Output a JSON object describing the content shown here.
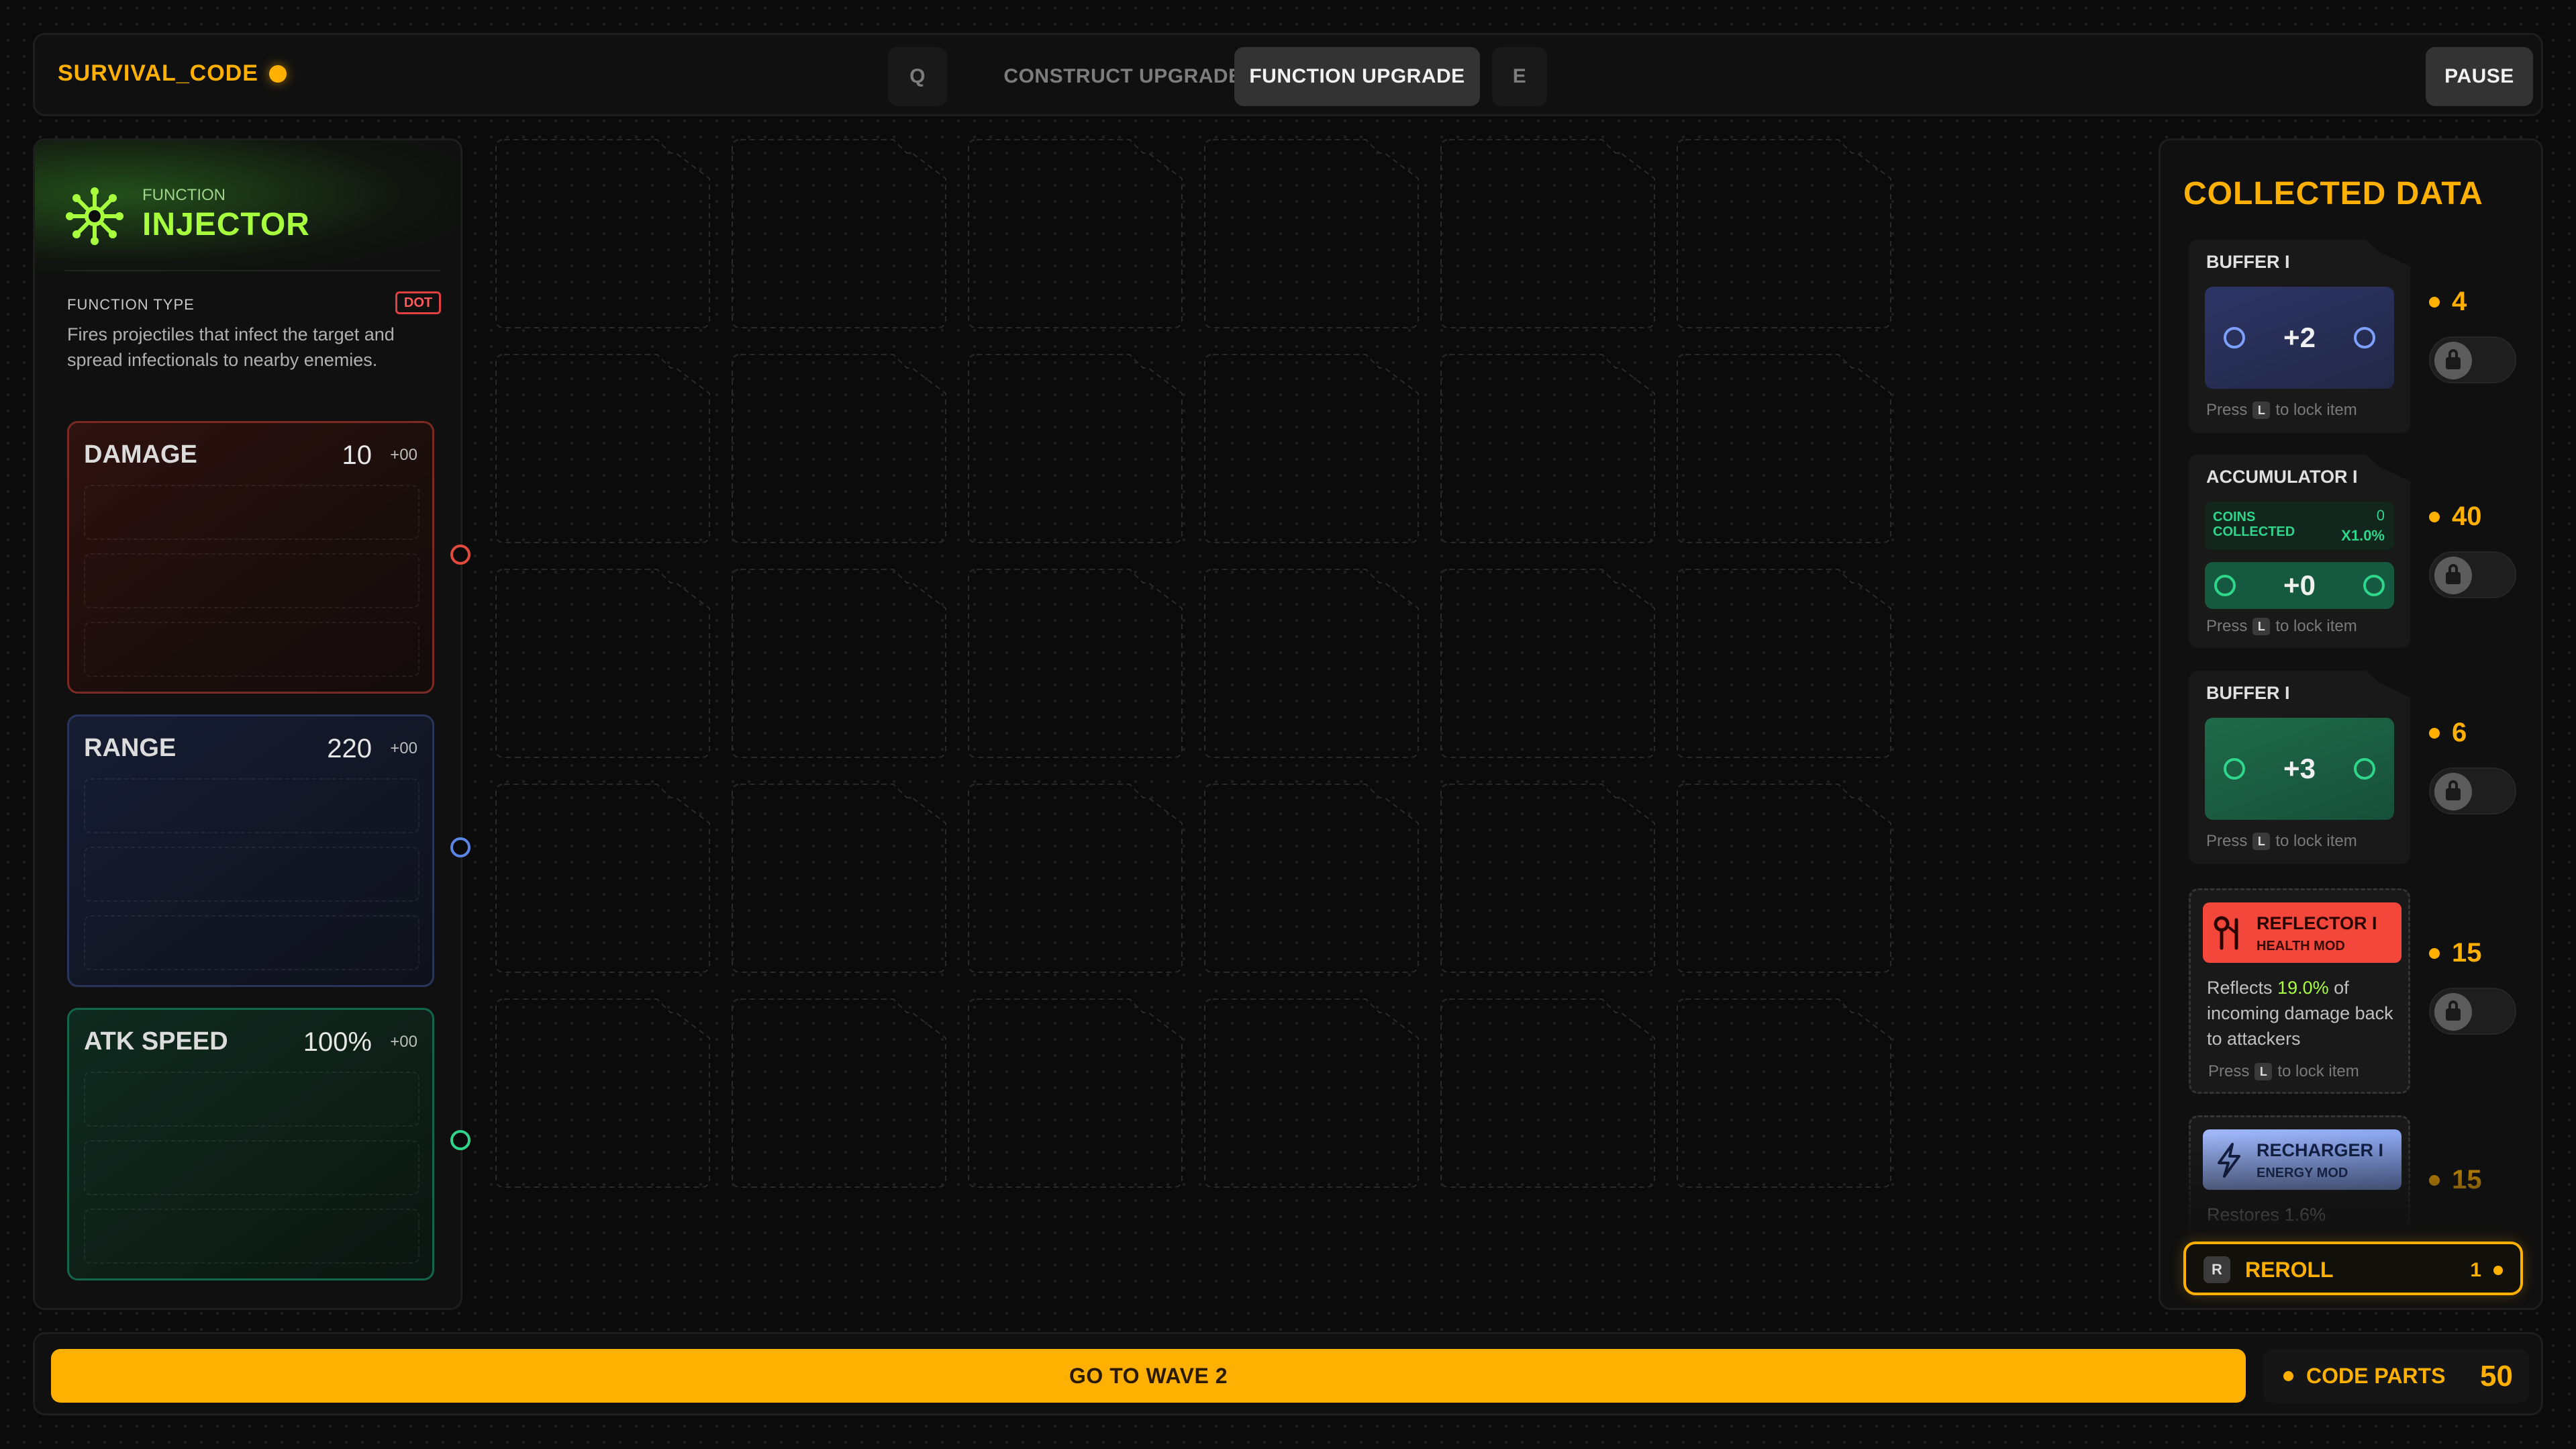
{
  "topbar": {
    "brand": "SURVIVAL_CODE",
    "key_left": "Q",
    "tab_construct": "CONSTRUCT UPGRADE",
    "tab_function": "FUNCTION UPGRADE",
    "key_right": "E",
    "pause": "PAUSE"
  },
  "function": {
    "label": "FUNCTION",
    "name": "INJECTOR",
    "icon": "asterisk-virus-icon",
    "type_label": "FUNCTION TYPE",
    "type_badge": "DOT",
    "description": "Fires projectiles that infect the target and spread infectionals to nearby enemies."
  },
  "stats": [
    {
      "name": "DAMAGE",
      "value": "10",
      "bonus": "+00",
      "color": "#e24a3e"
    },
    {
      "name": "RANGE",
      "value": "220",
      "bonus": "+00",
      "color": "#5a86e6"
    },
    {
      "name": "ATK SPEED",
      "value": "100%",
      "bonus": "+00",
      "color": "#2fd58a"
    }
  ],
  "collected": {
    "title": "COLLECTED DATA",
    "lock_hint_prefix": "Press",
    "lock_hint_key": "L",
    "lock_hint_suffix": "to lock item",
    "items": [
      {
        "title": "BUFFER I",
        "value": "+2",
        "price": "4"
      },
      {
        "title": "ACCUMULATOR I",
        "coins_label": "COINS COLLECTED",
        "coins_value": "0",
        "multiplier": "X1.0%",
        "value": "+0",
        "price": "40"
      },
      {
        "title": "BUFFER I",
        "value": "+3",
        "price": "6"
      },
      {
        "title": "REFLECTOR I",
        "subtitle": "HEALTH MOD",
        "desc_pre": "Reflects ",
        "desc_value": "19.0%",
        "desc_post": " of incoming damage back to attackers",
        "price": "15"
      },
      {
        "title": "RECHARGER I",
        "subtitle": "ENERGY MOD",
        "desc_partial": "Restores 1.6%",
        "price": "15"
      }
    ]
  },
  "reroll": {
    "key": "R",
    "label": "REROLL",
    "cost": "1"
  },
  "bottom": {
    "wave_button": "GO TO WAVE 2",
    "code_parts_label": "CODE PARTS",
    "code_parts_value": "50"
  },
  "colors": {
    "accent": "#ffb000",
    "function_green": "#a8ff3e",
    "reflector_red": "#ff4a3a",
    "recharger_blue": "#8aa8f0"
  }
}
